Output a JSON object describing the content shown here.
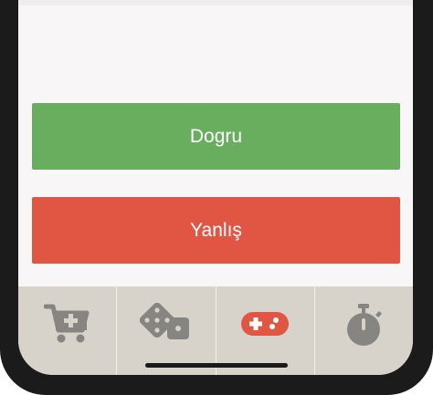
{
  "answers": {
    "true_label": "Dogru",
    "false_label": "Yanlış"
  },
  "tabs": [
    {
      "icon": "cart-plus-icon",
      "active": false
    },
    {
      "icon": "dice-icon",
      "active": false
    },
    {
      "icon": "gamepad-icon",
      "active": true
    },
    {
      "icon": "stopwatch-icon",
      "active": false
    }
  ],
  "colors": {
    "true_button": "#69ae5e",
    "false_button": "#e05643",
    "tab_bar": "#d7d3cb",
    "icon_inactive": "#878582",
    "icon_active": "#e05643"
  }
}
